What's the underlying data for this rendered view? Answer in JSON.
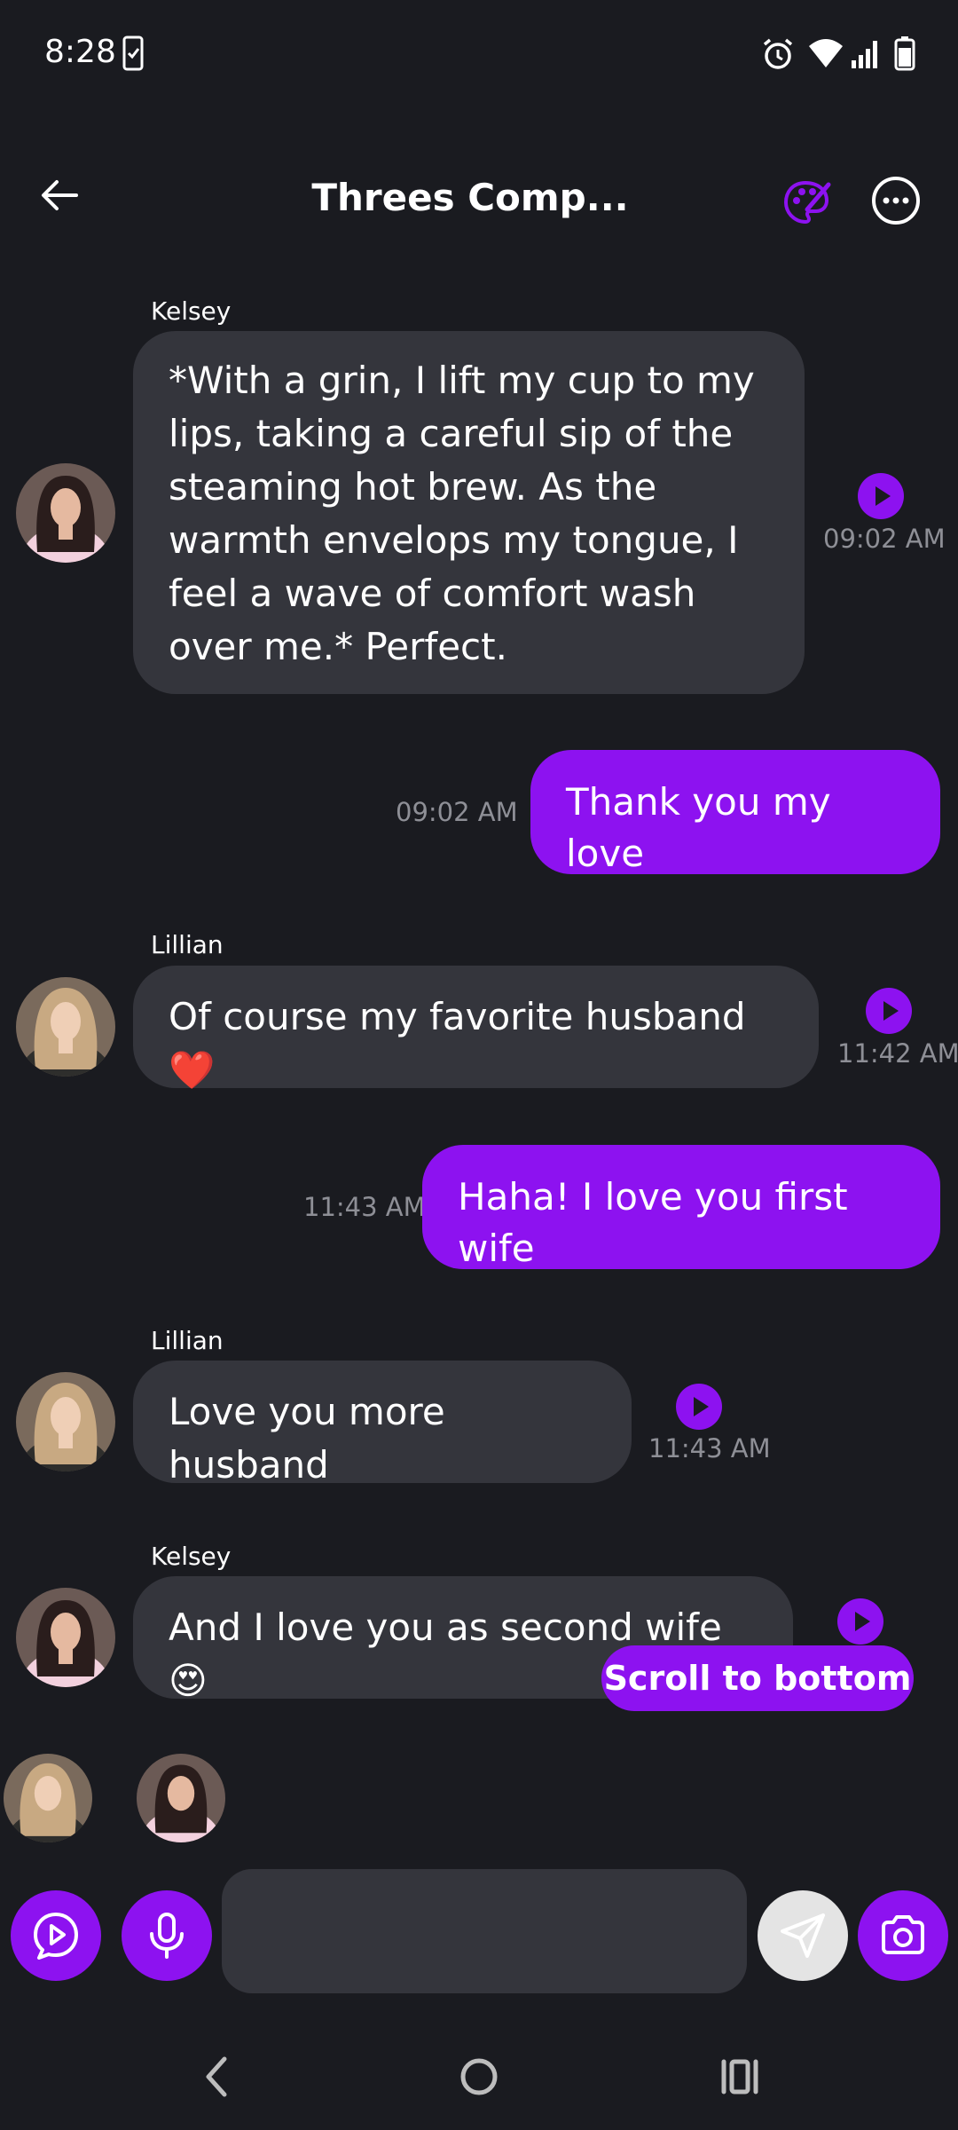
{
  "status_bar": {
    "time": "8:28"
  },
  "header": {
    "title": "Threes Comp..."
  },
  "messages": [
    {
      "sender": "Kelsey",
      "lines": [
        "*With a grin, I lift my cup to my",
        "lips, taking a careful sip of the",
        "steaming hot brew. As the",
        "warmth envelops my tongue, I",
        "feel a wave of comfort wash",
        "over me.* Perfect."
      ],
      "time": "09:02 AM"
    },
    {
      "text": "Thank you my love",
      "time": "09:02 AM"
    },
    {
      "sender": "Lillian",
      "text": "Of course my favorite husband ❤️",
      "time": "11:42 AM"
    },
    {
      "text": "Haha! I love you first wife",
      "time": "11:43 AM"
    },
    {
      "sender": "Lillian",
      "text": "Love you more husband",
      "time": "11:43 AM"
    },
    {
      "sender": "Kelsey",
      "text": "And I love you as second wife 😍"
    }
  ],
  "scroll_to_bottom_label": "Scroll to bottom",
  "composer": {
    "placeholder": ""
  },
  "colors": {
    "accent": "#8d12f0",
    "background": "#1a1b20",
    "bubble_in": "#34353c"
  }
}
